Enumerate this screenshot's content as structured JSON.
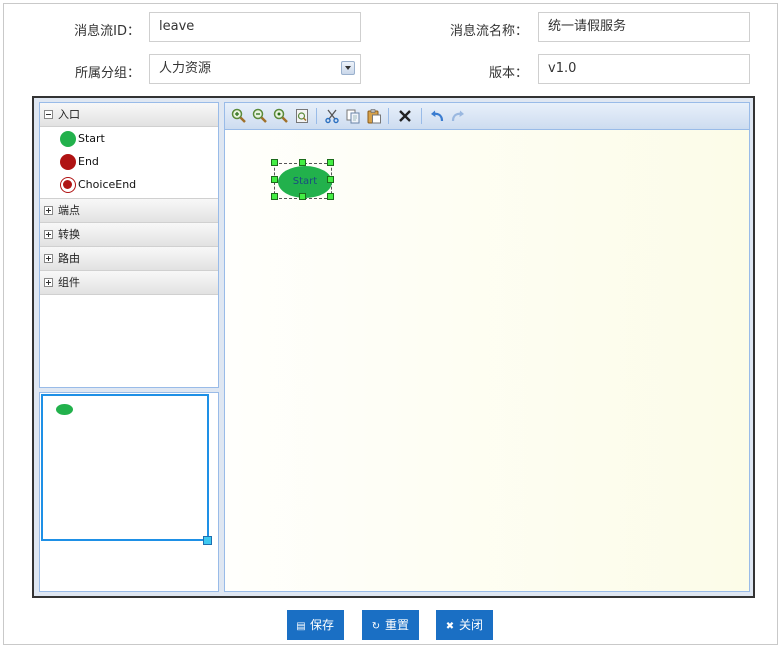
{
  "form": {
    "flow_id_label": "消息流ID：",
    "flow_id_value": "leave",
    "flow_name_label": "消息流名称：",
    "flow_name_value": "统一请假服务",
    "group_label": "所属分组：",
    "group_value": "人力资源",
    "version_label": "版本：",
    "version_value": "v1.0"
  },
  "palette": {
    "sections": [
      {
        "label": "入口",
        "expanded": true
      },
      {
        "label": "端点",
        "expanded": false
      },
      {
        "label": "转换",
        "expanded": false
      },
      {
        "label": "路由",
        "expanded": false
      },
      {
        "label": "组件",
        "expanded": false
      }
    ],
    "entry_items": [
      {
        "label": "Start",
        "color": "#22b14c"
      },
      {
        "label": "End",
        "color": "#b01313"
      },
      {
        "label": "ChoiceEnd",
        "color": "#b01313"
      }
    ]
  },
  "toolbar": {
    "icons": [
      "zoom-in-icon",
      "zoom-out-icon",
      "zoom-actual-icon",
      "fit-page-icon",
      "cut-icon",
      "copy-icon",
      "paste-icon",
      "delete-icon",
      "undo-icon",
      "redo-icon"
    ]
  },
  "canvas": {
    "start_node_label": "Start",
    "node_color": "#22b14c"
  },
  "buttons": {
    "save_label": "保存",
    "reset_label": "重置",
    "close_label": "关闭",
    "color": "#1a6fc4"
  }
}
